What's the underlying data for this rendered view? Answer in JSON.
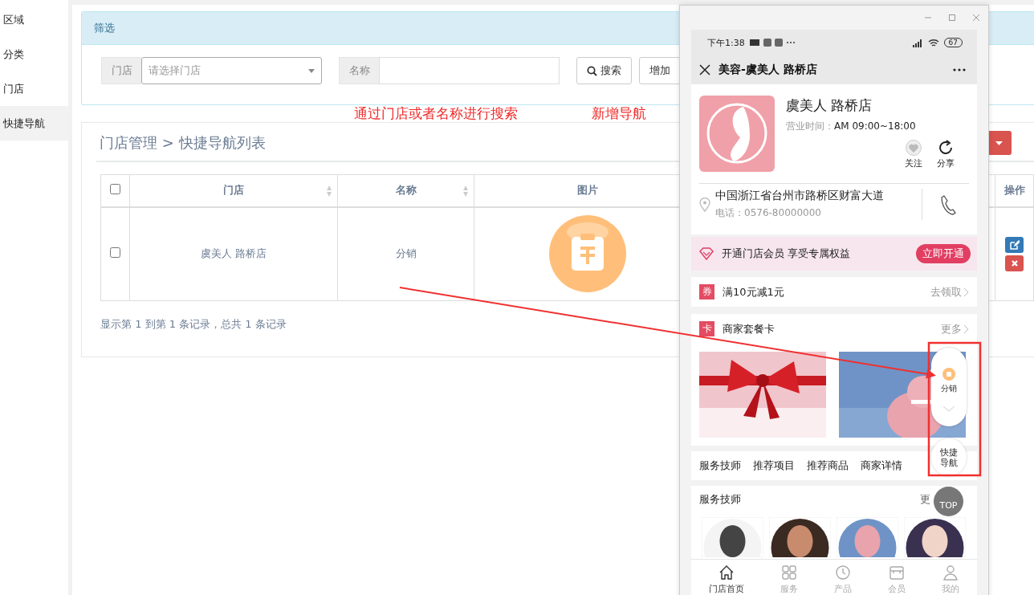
{
  "sidebar": {
    "items": [
      {
        "label": "区域",
        "selected": false
      },
      {
        "label": "分类",
        "selected": false
      },
      {
        "label": "门店",
        "selected": false
      },
      {
        "label": "快捷导航",
        "selected": true
      }
    ]
  },
  "filter": {
    "title": "筛选",
    "fields": [
      {
        "kind": "select",
        "label": "门店",
        "placeholder": "请选择门店"
      },
      {
        "kind": "text",
        "label": "名称"
      }
    ],
    "buttons": [
      {
        "kind": "search",
        "label": "搜索"
      },
      {
        "kind": "plain",
        "label": "增加"
      }
    ]
  },
  "annotations": [
    "通过门店或者名称进行搜索",
    "新增导航"
  ],
  "list": {
    "breadcrumb": "门店管理 > 快捷导航列表",
    "columns": [
      {
        "kind": "check",
        "checked": false
      },
      {
        "kind": "sort",
        "label": "门店"
      },
      {
        "kind": "sort",
        "label": "名称"
      },
      {
        "kind": "plain",
        "label": "图片"
      },
      {
        "kind": "hidden"
      },
      {
        "kind": "plain",
        "label": "操作"
      }
    ],
    "rows": [
      {
        "checked": false,
        "store": "虞美人 路桥店",
        "name": "分销"
      }
    ],
    "footer": "显示第 1 到第 1 条记录，总共 1 条记录"
  },
  "phone": {
    "status": {
      "time": "下午1:38",
      "battery": "67"
    },
    "title": "美容-虞美人 路桥店",
    "store": {
      "name": "虞美人 路桥店",
      "hours_label": "营业时间：",
      "hours": "AM 09:00~18:00",
      "actions": [
        {
          "kind": "follow",
          "label": "关注"
        },
        {
          "kind": "share",
          "label": "分享"
        }
      ],
      "address": "中国浙江省台州市路桥区财富大道",
      "tel": "电话：0576-80000000"
    },
    "member": {
      "text": "开通门店会员 享受专属权益",
      "button": "立即开通"
    },
    "coupon": {
      "badge": "券",
      "text": "满10元减1元",
      "link": "去领取"
    },
    "cards": {
      "badge": "卡",
      "title": "商家套餐卡",
      "link": "更多"
    },
    "tabs": [
      "服务技师",
      "推荐项目",
      "推荐商品",
      "商家详情"
    ],
    "technicians": {
      "title": "服务技师",
      "link": "更"
    },
    "float_nav": {
      "item": "分销",
      "toggle": "快捷导航"
    },
    "top_button": "TOP",
    "bottom_nav": [
      {
        "kind": "home",
        "label": "门店首页",
        "selected": true
      },
      {
        "kind": "grid",
        "label": "服务",
        "selected": false
      },
      {
        "kind": "clock",
        "label": "产品",
        "selected": false
      },
      {
        "kind": "shop",
        "label": "会员",
        "selected": false
      },
      {
        "kind": "user",
        "label": "我的",
        "selected": false
      }
    ]
  }
}
